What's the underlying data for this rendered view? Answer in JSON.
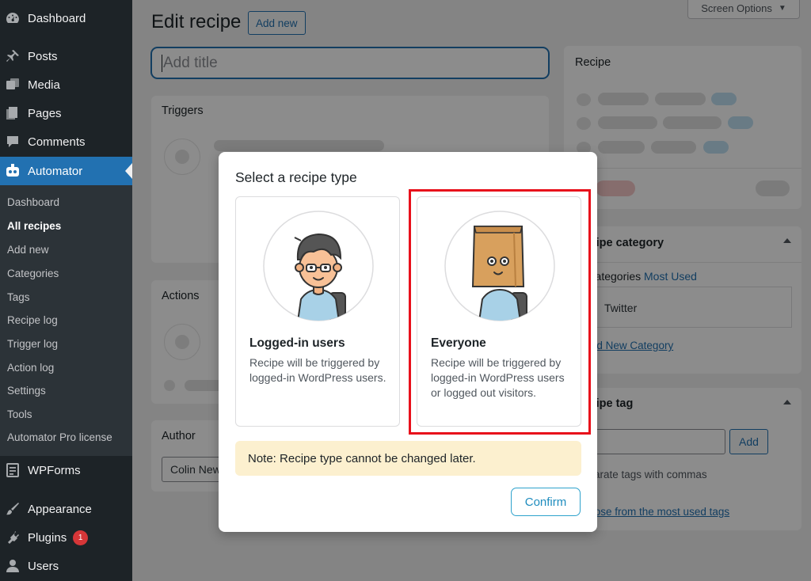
{
  "sidebar": {
    "menu": [
      {
        "label": "Dashboard",
        "icon": "dashboard-icon"
      },
      {
        "label": "Posts",
        "icon": "pushpin-icon"
      },
      {
        "label": "Media",
        "icon": "media-icon"
      },
      {
        "label": "Pages",
        "icon": "pages-icon"
      },
      {
        "label": "Comments",
        "icon": "comment-icon"
      },
      {
        "label": "Automator",
        "icon": "robot-icon"
      }
    ],
    "submenu": [
      "Dashboard",
      "All recipes",
      "Add new",
      "Categories",
      "Tags",
      "Recipe log",
      "Trigger log",
      "Action log",
      "Settings",
      "Tools",
      "Automator Pro license"
    ],
    "menu_bottom": [
      {
        "label": "WPForms",
        "icon": "wpforms-icon"
      },
      {
        "label": "Appearance",
        "icon": "paintbrush-icon"
      },
      {
        "label": "Plugins",
        "icon": "plug-icon",
        "badge": "1"
      },
      {
        "label": "Users",
        "icon": "user-icon"
      }
    ]
  },
  "header": {
    "title": "Edit recipe",
    "add_new": "Add new",
    "screen_options": "Screen Options"
  },
  "title_input": {
    "placeholder": "Add title"
  },
  "panels": {
    "triggers": "Triggers",
    "actions": "Actions",
    "author": "Author",
    "author_value": "Colin Newcomer",
    "recipe": "Recipe"
  },
  "category_box": {
    "title": "Recipe category",
    "tab_all": "All Categories",
    "tab_used": "Most Used",
    "option": "Twitter",
    "add_link": "+ Add New Category"
  },
  "tag_box": {
    "title": "Recipe tag",
    "add_button": "Add",
    "hint": "Separate tags with commas",
    "choose_link": "Choose from the most used tags"
  },
  "modal": {
    "title": "Select a recipe type",
    "options": [
      {
        "title": "Logged-in users",
        "desc": "Recipe will be triggered by logged-in WordPress users."
      },
      {
        "title": "Everyone",
        "desc": "Recipe will be triggered by logged-in WordPress users or logged out visitors."
      }
    ],
    "note": "Note: Recipe type cannot be changed later.",
    "confirm": "Confirm"
  },
  "colors": {
    "sidebar_bg": "#1d2327",
    "accent": "#2271b1",
    "highlight_border": "#e8101b",
    "note_bg": "#fcf0cf"
  }
}
